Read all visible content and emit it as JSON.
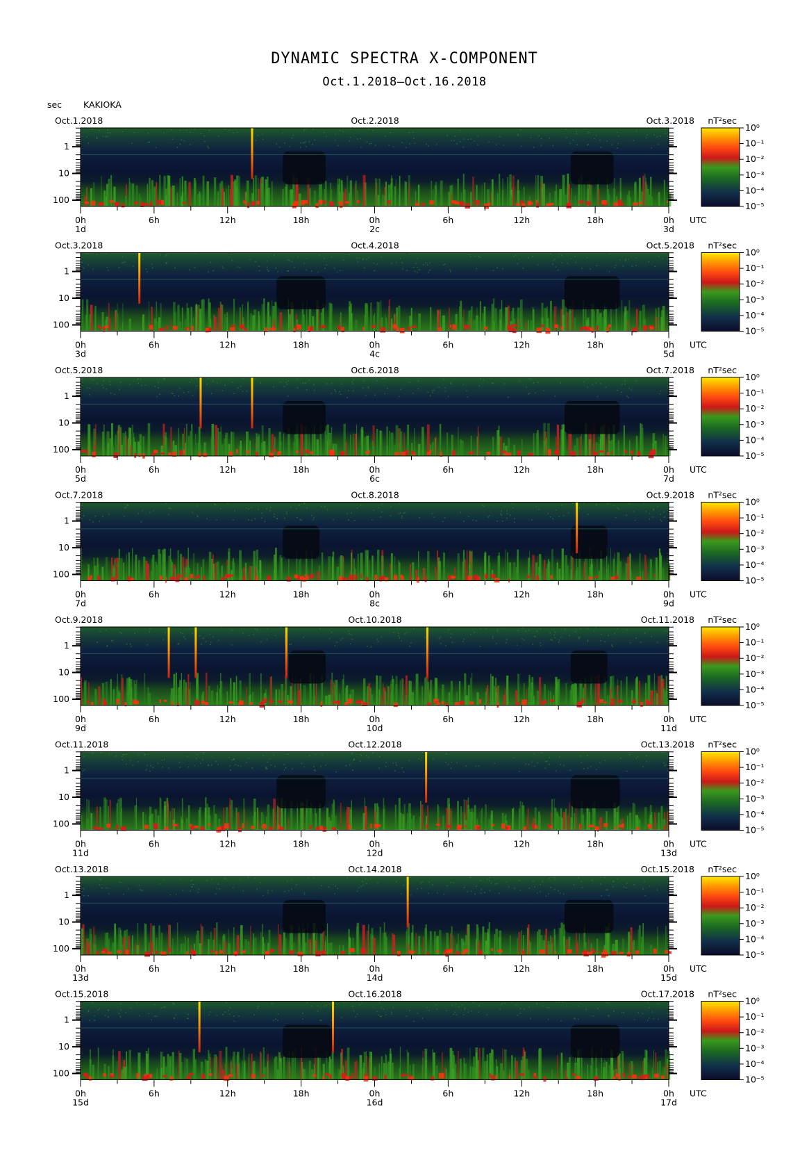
{
  "header": {
    "title": "DYNAMIC SPECTRA X-COMPONENT",
    "subtitle": "Oct.1.2018–Oct.16.2018",
    "unit_label": "sec",
    "station": "KAKIOKA"
  },
  "colors": {
    "background": "#0a0f1f",
    "scale": [
      "#101030",
      "#0d3a2a",
      "#1f7a1f",
      "#3aa022",
      "#d01c1c",
      "#ff5a10",
      "#ff9a00",
      "#ffe000"
    ]
  },
  "chart_data": [
    {
      "type": "heatmap",
      "panel": 1,
      "date_left": "Oct.1.2018",
      "date_mid": "Oct.2.2018",
      "date_right": "Oct.3.2018",
      "x_ticks": [
        "0h",
        "6h",
        "12h",
        "18h",
        "0h",
        "6h",
        "12h",
        "18h",
        "0h"
      ],
      "day_left": "1d",
      "day_mid": "2c",
      "day_right": "3d",
      "x_unit": "UTC",
      "y_ticks": [
        "1",
        "10",
        "100"
      ],
      "y_unit": "sec",
      "y_scale": "log",
      "colorbar_unit": "nT²sec",
      "colorbar_ticks": [
        "10⁰",
        "10⁻¹",
        "10⁻²",
        "10⁻³",
        "10⁻⁴",
        "10⁻⁵"
      ],
      "events_hours": [
        14.0
      ],
      "dark_ranges_hours": [
        [
          16.5,
          20.0
        ],
        [
          40.0,
          43.5
        ]
      ]
    },
    {
      "type": "heatmap",
      "panel": 2,
      "date_left": "Oct.3.2018",
      "date_mid": "Oct.4.2018",
      "date_right": "Oct.5.2018",
      "x_ticks": [
        "0h",
        "6h",
        "12h",
        "18h",
        "0h",
        "6h",
        "12h",
        "18h",
        "0h"
      ],
      "day_left": "3d",
      "day_mid": "4c",
      "day_right": "5d",
      "x_unit": "UTC",
      "y_ticks": [
        "1",
        "10",
        "100"
      ],
      "y_unit": "sec",
      "y_scale": "log",
      "colorbar_unit": "nT²sec",
      "colorbar_ticks": [
        "10⁰",
        "10⁻¹",
        "10⁻²",
        "10⁻³",
        "10⁻⁴",
        "10⁻⁵"
      ],
      "events_hours": [
        4.8
      ],
      "dark_ranges_hours": [
        [
          16.0,
          20.0
        ],
        [
          39.5,
          44.0
        ]
      ]
    },
    {
      "type": "heatmap",
      "panel": 3,
      "date_left": "Oct.5.2018",
      "date_mid": "Oct.6.2018",
      "date_right": "Oct.7.2018",
      "x_ticks": [
        "0h",
        "6h",
        "12h",
        "18h",
        "0h",
        "6h",
        "12h",
        "18h",
        "0h"
      ],
      "day_left": "5d",
      "day_mid": "6c",
      "day_right": "7d",
      "x_unit": "UTC",
      "y_ticks": [
        "1",
        "10",
        "100"
      ],
      "y_unit": "sec",
      "y_scale": "log",
      "colorbar_unit": "nT²sec",
      "colorbar_ticks": [
        "10⁰",
        "10⁻¹",
        "10⁻²",
        "10⁻³",
        "10⁻⁴",
        "10⁻⁵"
      ],
      "events_hours": [
        9.8,
        14.0
      ],
      "dark_ranges_hours": [
        [
          16.5,
          20.0
        ],
        [
          39.5,
          44.0
        ]
      ]
    },
    {
      "type": "heatmap",
      "panel": 4,
      "date_left": "Oct.7.2018",
      "date_mid": "Oct.8.2018",
      "date_right": "Oct.9.2018",
      "x_ticks": [
        "0h",
        "6h",
        "12h",
        "18h",
        "0h",
        "6h",
        "12h",
        "18h",
        "0h"
      ],
      "day_left": "7d",
      "day_mid": "8c",
      "day_right": "9d",
      "x_unit": "UTC",
      "y_ticks": [
        "1",
        "10",
        "100"
      ],
      "y_unit": "sec",
      "y_scale": "log",
      "colorbar_unit": "nT²sec",
      "colorbar_ticks": [
        "10⁰",
        "10⁻¹",
        "10⁻²",
        "10⁻³",
        "10⁻⁴",
        "10⁻⁵"
      ],
      "events_hours": [
        40.5
      ],
      "dark_ranges_hours": [
        [
          16.5,
          19.5
        ],
        [
          40.0,
          43.0
        ]
      ]
    },
    {
      "type": "heatmap",
      "panel": 5,
      "date_left": "Oct.9.2018",
      "date_mid": "Oct.10.2018",
      "date_right": "Oct.11.2018",
      "x_ticks": [
        "0h",
        "6h",
        "12h",
        "18h",
        "0h",
        "6h",
        "12h",
        "18h",
        "0h"
      ],
      "day_left": "9d",
      "day_mid": "10d",
      "day_right": "11d",
      "x_unit": "UTC",
      "y_ticks": [
        "1",
        "10",
        "100"
      ],
      "y_unit": "sec",
      "y_scale": "log",
      "colorbar_unit": "nT²sec",
      "colorbar_ticks": [
        "10⁰",
        "10⁻¹",
        "10⁻²",
        "10⁻³",
        "10⁻⁴",
        "10⁻⁵"
      ],
      "events_hours": [
        7.2,
        9.4,
        16.8,
        28.3
      ],
      "dark_ranges_hours": [
        [
          17.0,
          20.0
        ],
        [
          40.0,
          43.0
        ]
      ]
    },
    {
      "type": "heatmap",
      "panel": 6,
      "date_left": "Oct.11.2018",
      "date_mid": "Oct.12.2018",
      "date_right": "Oct.13.2018",
      "x_ticks": [
        "0h",
        "6h",
        "12h",
        "18h",
        "0h",
        "6h",
        "12h",
        "18h",
        "0h"
      ],
      "day_left": "11d",
      "day_mid": "12d",
      "day_right": "13d",
      "x_unit": "UTC",
      "y_ticks": [
        "1",
        "10",
        "100"
      ],
      "y_unit": "sec",
      "y_scale": "log",
      "colorbar_unit": "nT²sec",
      "colorbar_ticks": [
        "10⁰",
        "10⁻¹",
        "10⁻²",
        "10⁻³",
        "10⁻⁴",
        "10⁻⁵"
      ],
      "events_hours": [
        28.2
      ],
      "dark_ranges_hours": [
        [
          16.0,
          20.0
        ],
        [
          40.0,
          44.0
        ]
      ]
    },
    {
      "type": "heatmap",
      "panel": 7,
      "date_left": "Oct.13.2018",
      "date_mid": "Oct.14.2018",
      "date_right": "Oct.15.2018",
      "x_ticks": [
        "0h",
        "6h",
        "12h",
        "18h",
        "0h",
        "6h",
        "12h",
        "18h",
        "0h"
      ],
      "day_left": "13d",
      "day_mid": "14d",
      "day_right": "15d",
      "x_unit": "UTC",
      "y_ticks": [
        "1",
        "10",
        "100"
      ],
      "y_unit": "sec",
      "y_scale": "log",
      "colorbar_unit": "nT²sec",
      "colorbar_ticks": [
        "10⁰",
        "10⁻¹",
        "10⁻²",
        "10⁻³",
        "10⁻⁴",
        "10⁻⁵"
      ],
      "events_hours": [
        26.7
      ],
      "dark_ranges_hours": [
        [
          16.5,
          20.0
        ],
        [
          39.5,
          43.5
        ]
      ]
    },
    {
      "type": "heatmap",
      "panel": 8,
      "date_left": "Oct.15.2018",
      "date_mid": "Oct.16.2018",
      "date_right": "Oct.17.2018",
      "x_ticks": [
        "0h",
        "6h",
        "12h",
        "18h",
        "0h",
        "6h",
        "12h",
        "18h",
        "0h"
      ],
      "day_left": "15d",
      "day_mid": "16d",
      "day_right": "17d",
      "x_unit": "UTC",
      "y_ticks": [
        "1",
        "10",
        "100"
      ],
      "y_unit": "sec",
      "y_scale": "log",
      "colorbar_unit": "nT²sec",
      "colorbar_ticks": [
        "10⁰",
        "10⁻¹",
        "10⁻²",
        "10⁻³",
        "10⁻⁴",
        "10⁻⁵"
      ],
      "events_hours": [
        9.7,
        20.6
      ],
      "dark_ranges_hours": [
        [
          16.5,
          20.5
        ],
        [
          40.0,
          44.0
        ]
      ]
    }
  ]
}
